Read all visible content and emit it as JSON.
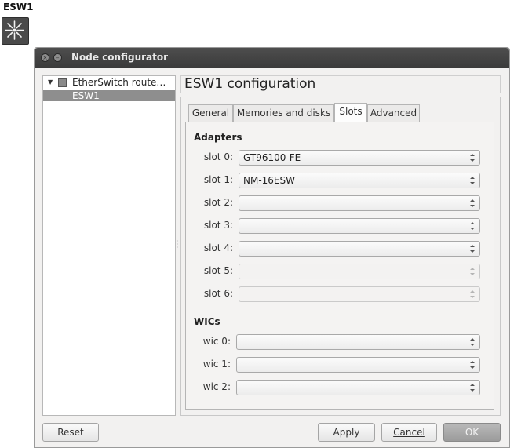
{
  "node": {
    "label": "ESW1",
    "icon": "ethernet-switch-icon"
  },
  "window": {
    "title": "Node configurator",
    "close_icon": "close-icon",
    "minimize_icon": "minimize-icon"
  },
  "tree": {
    "parent_label": "EtherSwitch route…",
    "parent_icon": "router-icon",
    "child_label": "ESW1"
  },
  "config": {
    "title": "ESW1 configuration",
    "tabs": [
      {
        "label": "General"
      },
      {
        "label": "Memories and disks"
      },
      {
        "label": "Slots"
      },
      {
        "label": "Advanced"
      }
    ],
    "active_tab": "Slots"
  },
  "adapters": {
    "title": "Adapters",
    "slots": [
      {
        "label": "slot 0:",
        "value": "GT96100-FE",
        "enabled": true
      },
      {
        "label": "slot 1:",
        "value": "NM-16ESW",
        "enabled": true
      },
      {
        "label": "slot 2:",
        "value": "",
        "enabled": true
      },
      {
        "label": "slot 3:",
        "value": "",
        "enabled": true
      },
      {
        "label": "slot 4:",
        "value": "",
        "enabled": true
      },
      {
        "label": "slot 5:",
        "value": "",
        "enabled": false
      },
      {
        "label": "slot 6:",
        "value": "",
        "enabled": false
      }
    ]
  },
  "wics": {
    "title": "WICs",
    "slots": [
      {
        "label": "wic 0:",
        "value": ""
      },
      {
        "label": "wic 1:",
        "value": ""
      },
      {
        "label": "wic 2:",
        "value": ""
      }
    ]
  },
  "buttons": {
    "reset": "Reset",
    "apply": "Apply",
    "cancel": "Cancel",
    "ok": "OK"
  }
}
